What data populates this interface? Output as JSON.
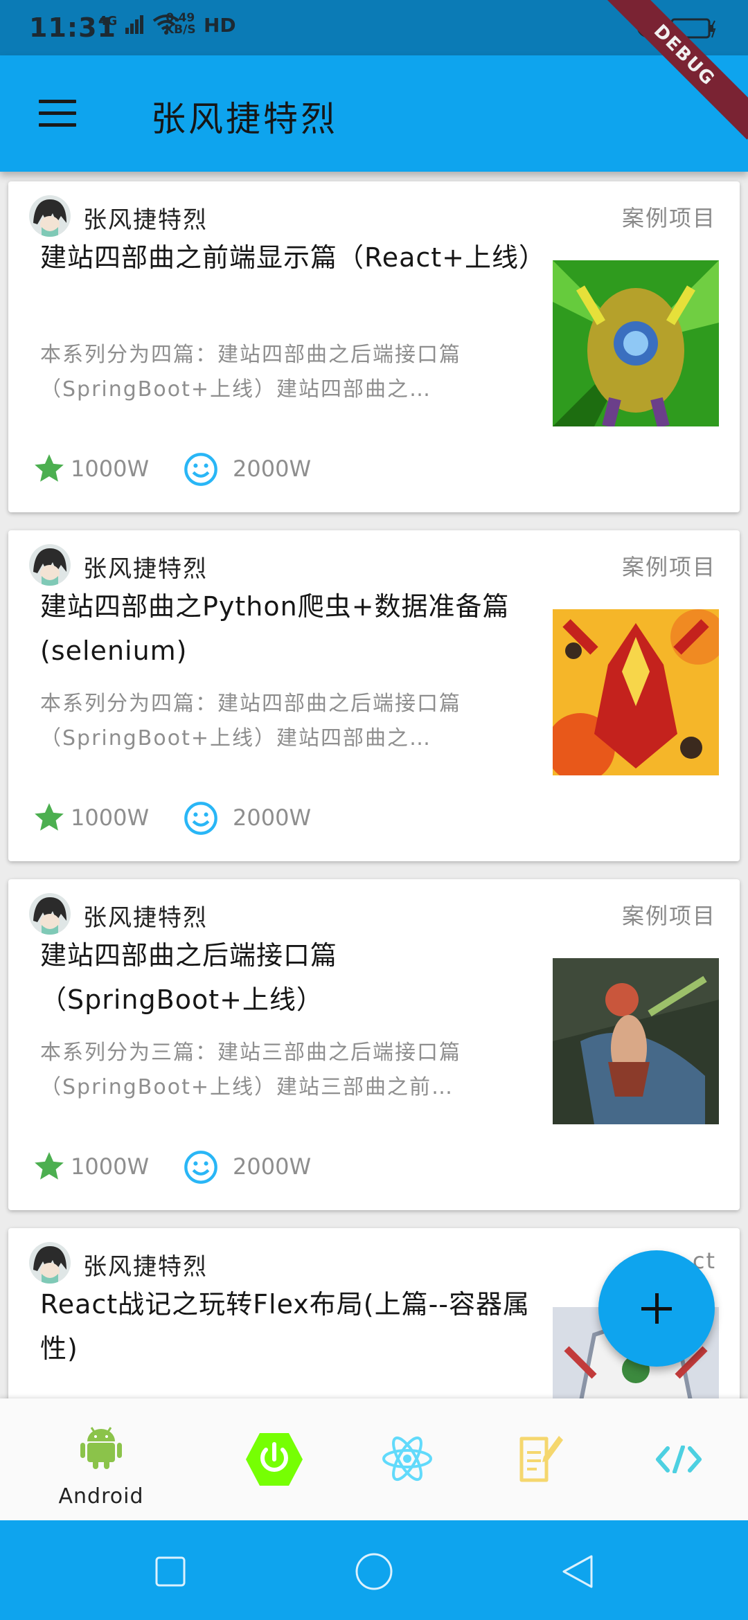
{
  "status_bar": {
    "time": "11:31",
    "network": "4G",
    "speed_value": "0.49",
    "speed_unit": "KB/S",
    "hd": "HD"
  },
  "debug_banner": "DEBUG",
  "app_bar": {
    "title": "张风捷特烈",
    "menu_icon": "hamburger-menu-icon"
  },
  "cards": [
    {
      "author": "张风捷特烈",
      "category": "案例项目",
      "title": "建站四部曲之前端显示篇（React+上线）",
      "description": "本系列分为四篇：建站四部曲之后端接口篇（SpringBoot+上线）建站四部曲之…",
      "likes": "1000W",
      "views": "2000W",
      "thumb_colors": [
        "#2f9b1e",
        "#b5a12b",
        "#e6e03a"
      ]
    },
    {
      "author": "张风捷特烈",
      "category": "案例项目",
      "title": "建站四部曲之Python爬虫+数据准备篇(selenium)",
      "description": "本系列分为四篇：建站四部曲之后端接口篇（SpringBoot+上线）建站四部曲之…",
      "likes": "1000W",
      "views": "2000W",
      "thumb_colors": [
        "#e8581a",
        "#f5b629",
        "#c4221d"
      ]
    },
    {
      "author": "张风捷特烈",
      "category": "案例项目",
      "title": "建站四部曲之后端接口篇（SpringBoot+上线）",
      "description": "本系列分为三篇：建站三部曲之后端接口篇（SpringBoot+上线）建站三部曲之前…",
      "likes": "1000W",
      "views": "2000W",
      "thumb_colors": [
        "#2f3a2c",
        "#4f7aa8",
        "#c9563c"
      ]
    },
    {
      "author": "张风捷特烈",
      "category": "ct",
      "title": "React战记之玩转Flex布局(上篇--容器属性)",
      "description": "",
      "likes": "",
      "views": "",
      "thumb_colors": [
        "#d8dde6",
        "#3c8a3e",
        "#f2f2f2"
      ]
    }
  ],
  "fab_icon": "plus-icon",
  "bottom_nav": [
    {
      "icon": "android-icon",
      "label": "Android",
      "color": "#8BC34A"
    },
    {
      "icon": "power-icon",
      "label": "",
      "color": "#76FF03"
    },
    {
      "icon": "react-atom-icon",
      "label": "",
      "color": "#61DAFB"
    },
    {
      "icon": "note-edit-icon",
      "label": "",
      "color": "#F5D76E"
    },
    {
      "icon": "code-icon",
      "label": "",
      "color": "#4DD0E1"
    }
  ],
  "system_nav": [
    "square-recents-icon",
    "circle-home-icon",
    "triangle-back-icon"
  ],
  "colors": {
    "primary": "#0EA4EE",
    "status_bar": "#0B7BB6",
    "star": "#4CAF50",
    "smile": "#29B6F6"
  }
}
